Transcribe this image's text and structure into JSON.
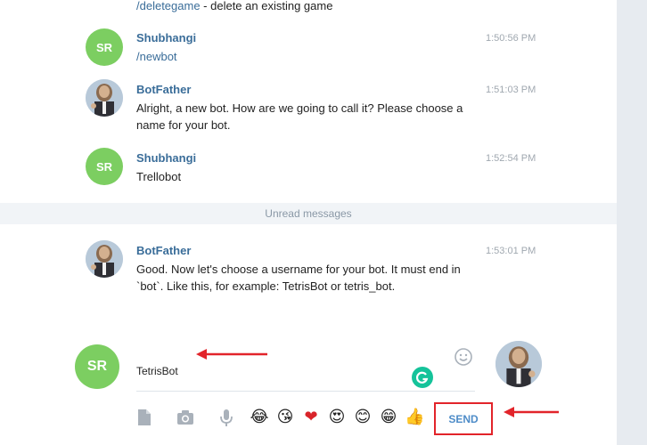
{
  "colors": {
    "accent": "#3a6d99",
    "avatar_sr": "#7cce61",
    "annotation": "#e2242a",
    "send": "#4e8cc8"
  },
  "messages": [
    {
      "text_prefix_cmd": "/deletegame",
      "text_rest": " - delete an existing game"
    },
    {
      "author": "Shubhangi",
      "avatar": "SR",
      "time": "1:50:56 PM",
      "text": "/newbot"
    },
    {
      "author": "BotFather",
      "avatar": "botfather-avatar",
      "time": "1:51:03 PM",
      "text": "Alright, a new bot. How are we going to call it? Please choose a name for your bot."
    },
    {
      "author": "Shubhangi",
      "avatar": "SR",
      "time": "1:52:54 PM",
      "text": "Trellobot"
    },
    {
      "author": "BotFather",
      "avatar": "botfather-avatar",
      "time": "1:53:01 PM",
      "text": "Good. Now let's choose a username for your bot. It must end in `bot`. Like this, for example: TetrisBot or tetris_bot."
    }
  ],
  "unread_label": "Unread messages",
  "composer": {
    "avatar": "SR",
    "input_value": "TetrisBot",
    "send_label": "SEND",
    "icons": [
      "document-icon",
      "camera-icon",
      "microphone-icon",
      "smile-icon",
      "grammarly-icon"
    ],
    "emojis": [
      "😂",
      "😘",
      "❤",
      "😍",
      "😊",
      "😁",
      "👍"
    ]
  }
}
